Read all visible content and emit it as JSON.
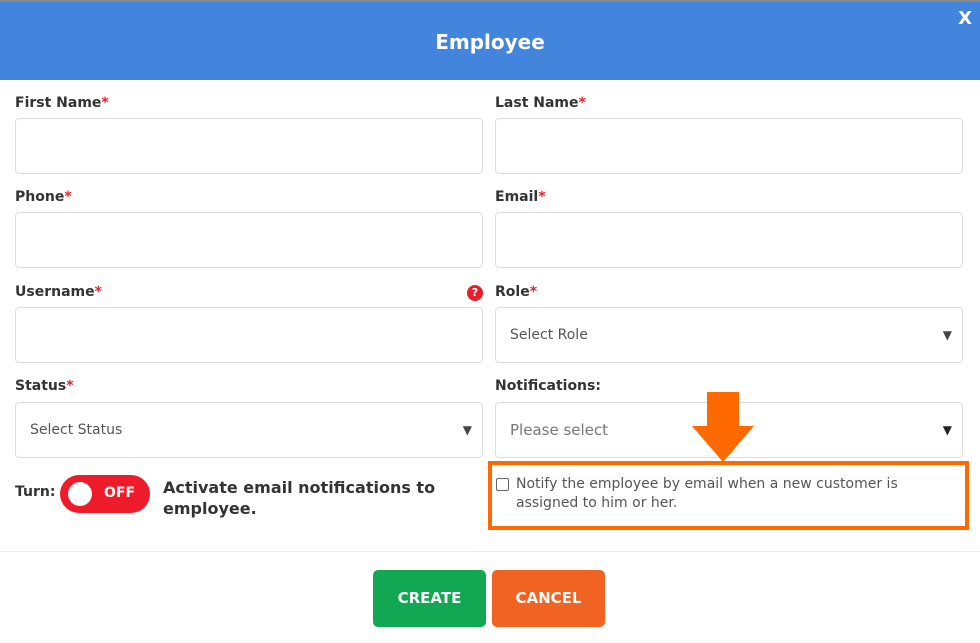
{
  "modal": {
    "title": "Employee",
    "close_label": "X"
  },
  "fields": {
    "first_name": {
      "label": "First Name",
      "required": "*",
      "value": ""
    },
    "last_name": {
      "label": "Last Name",
      "required": "*",
      "value": ""
    },
    "phone": {
      "label": "Phone",
      "required": "*",
      "value": ""
    },
    "email": {
      "label": "Email",
      "required": "*",
      "value": ""
    },
    "username": {
      "label": "Username",
      "required": "*",
      "value": "",
      "help_icon": "?"
    },
    "role": {
      "label": "Role",
      "required": "*",
      "placeholder": "Select Role"
    },
    "status": {
      "label": "Status",
      "required": "*",
      "placeholder": "Select Status"
    },
    "notifications": {
      "label": "Notifications:",
      "placeholder": "Please select"
    }
  },
  "toggle": {
    "label": "Turn:",
    "state": "OFF",
    "description": "Activate email notifications to employee."
  },
  "notify_checkbox": {
    "label": "Notify the employee by email when a new customer is assigned to him or her.",
    "checked": false
  },
  "colors": {
    "header": "#4385dc",
    "create": "#12a853",
    "cancel": "#f06322",
    "highlight": "#ff6a00",
    "toggle_off": "#ee1c2a"
  },
  "buttons": {
    "create": "CREATE",
    "cancel": "CANCEL"
  }
}
